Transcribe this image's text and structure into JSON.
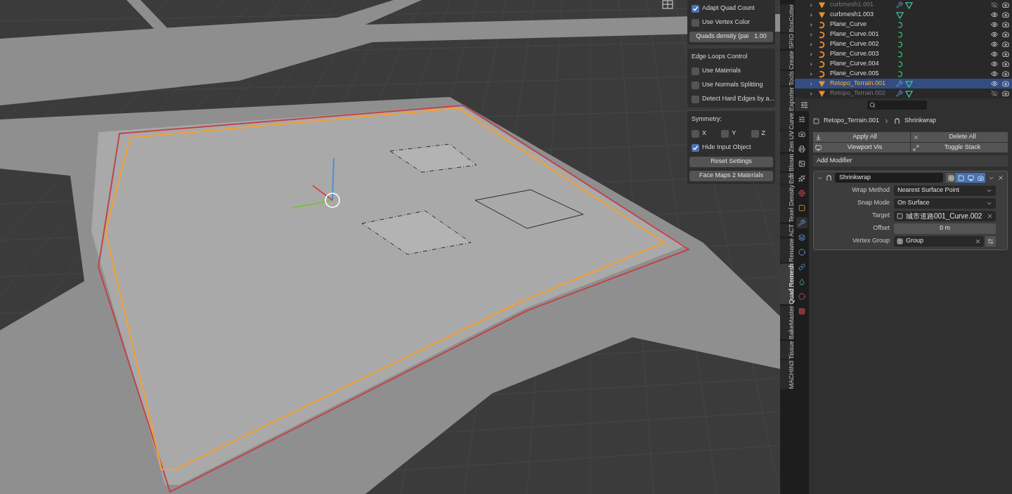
{
  "remesh_panel": {
    "sections": [
      {
        "items": [
          {
            "kind": "checkbox",
            "label": "Adapt Quad Count",
            "checked": true
          },
          {
            "kind": "checkbox",
            "label": "Use Vertex Color",
            "checked": false
          },
          {
            "kind": "field",
            "label": "Quads density (pai",
            "value": "1.00"
          }
        ]
      },
      {
        "items": [
          {
            "kind": "heading",
            "label": "Edge Loops Control"
          },
          {
            "kind": "checkbox",
            "label": "Use Materials",
            "checked": false
          },
          {
            "kind": "checkbox",
            "label": "Use Normals Splitting",
            "checked": false
          },
          {
            "kind": "checkbox",
            "label": "Detect Hard Edges by a...",
            "checked": false
          }
        ]
      },
      {
        "items": [
          {
            "kind": "heading",
            "label": "Symmetry:"
          },
          {
            "kind": "axes",
            "axes": [
              {
                "label": "X",
                "checked": false
              },
              {
                "label": "Y",
                "checked": false
              },
              {
                "label": "Z",
                "checked": false
              }
            ]
          },
          {
            "kind": "checkbox",
            "label": "Hide Input Object",
            "checked": true
          },
          {
            "kind": "button",
            "label": "Reset Settings"
          },
          {
            "kind": "button",
            "label": "Face Maps 2 Materials"
          }
        ]
      }
    ]
  },
  "sidebar_tabs": [
    {
      "label": "BoxCutter",
      "selected": false
    },
    {
      "label": "SPIO",
      "selected": false
    },
    {
      "label": "Create",
      "selected": false
    },
    {
      "label": "Tools",
      "selected": false
    },
    {
      "label": "Curve Exporter",
      "selected": false
    },
    {
      "label": "Zen UV",
      "selected": false
    },
    {
      "label": "Blosm",
      "selected": false
    },
    {
      "label": "Edit",
      "selected": false
    },
    {
      "label": "Texel Density",
      "selected": false
    },
    {
      "label": "ACT",
      "selected": false
    },
    {
      "label": "Rename",
      "selected": false
    },
    {
      "label": "Quad Remesh",
      "selected": true
    },
    {
      "label": "BakeMaster",
      "selected": false
    },
    {
      "label": "Tissue",
      "selected": false
    },
    {
      "label": "MACHIN3",
      "selected": false
    }
  ],
  "outliner": {
    "rows": [
      {
        "name": "curbmesh1.001",
        "kind": "mesh",
        "has_modifiers": true,
        "visible": false,
        "selected": false
      },
      {
        "name": "curbmesh1.003",
        "kind": "mesh",
        "has_modifiers": false,
        "visible": true,
        "selected": false
      },
      {
        "name": "Plane_Curve",
        "kind": "curve",
        "has_modifiers": false,
        "visible": true,
        "selected": false
      },
      {
        "name": "Plane_Curve.001",
        "kind": "curve",
        "has_modifiers": false,
        "visible": true,
        "selected": false
      },
      {
        "name": "Plane_Curve.002",
        "kind": "curve",
        "has_modifiers": false,
        "visible": true,
        "selected": false
      },
      {
        "name": "Plane_Curve.003",
        "kind": "curve",
        "has_modifiers": false,
        "visible": true,
        "selected": false
      },
      {
        "name": "Plane_Curve.004",
        "kind": "curve",
        "has_modifiers": false,
        "visible": true,
        "selected": false
      },
      {
        "name": "Plane_Curve.005",
        "kind": "curve",
        "has_modifiers": false,
        "visible": true,
        "selected": false
      },
      {
        "name": "Retopo_Terrain.001",
        "kind": "mesh",
        "has_modifiers": true,
        "visible": true,
        "selected": true
      },
      {
        "name": "Retopo_Terrain.002",
        "kind": "mesh",
        "has_modifiers": true,
        "visible": false,
        "selected": false
      }
    ]
  },
  "properties": {
    "tabs": [
      {
        "kind": "tool",
        "selected": false
      },
      {
        "kind": "render",
        "selected": false
      },
      {
        "kind": "output",
        "selected": false
      },
      {
        "kind": "view_layer",
        "selected": false
      },
      {
        "kind": "scene",
        "selected": false
      },
      {
        "kind": "world",
        "selected": false
      },
      {
        "kind": "object",
        "selected": false
      },
      {
        "kind": "modifiers",
        "selected": true
      },
      {
        "kind": "particles",
        "selected": false
      },
      {
        "kind": "physics",
        "selected": false
      },
      {
        "kind": "constraints",
        "selected": false
      },
      {
        "kind": "data",
        "selected": false
      },
      {
        "kind": "material",
        "selected": false
      },
      {
        "kind": "texture",
        "selected": false
      }
    ],
    "breadcrumb": {
      "object": "Retopo_Terrain.001",
      "modifier": "Shrinkwrap"
    },
    "actions": [
      {
        "kind": "apply",
        "label": "Apply All"
      },
      {
        "kind": "delete",
        "label": "Delete All"
      },
      {
        "kind": "viewport",
        "label": "Viewport Vis"
      },
      {
        "kind": "toggle",
        "label": "Toggle Stack"
      }
    ],
    "add_modifier": "Add Modifier",
    "modifier": {
      "name": "Shrinkwrap",
      "expanded": true,
      "on_cage": false,
      "edit_mode": true,
      "viewport": true,
      "render": true,
      "fields": [
        {
          "kind": "dropdown",
          "label": "Wrap Method",
          "value": "Nearest Surface Point"
        },
        {
          "kind": "dropdown",
          "label": "Snap Mode",
          "value": "On Surface"
        },
        {
          "kind": "object",
          "label": "Target",
          "value": "城市道路001_Curve.002"
        },
        {
          "kind": "number",
          "label": "Offset",
          "value": "0 m"
        },
        {
          "kind": "group",
          "label": "Vertex Group",
          "value": "Group"
        }
      ]
    }
  }
}
